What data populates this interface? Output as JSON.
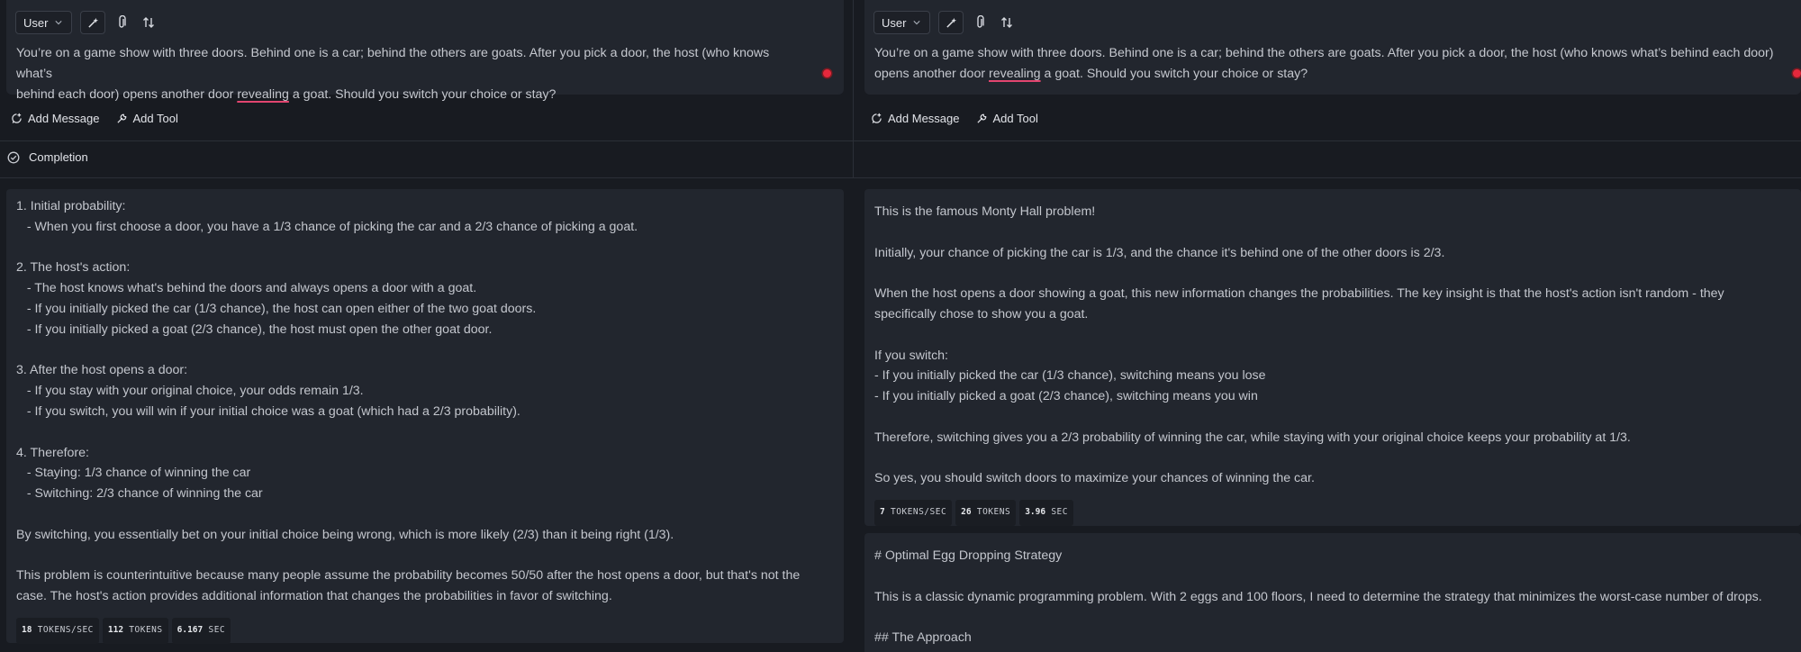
{
  "left": {
    "role": "User",
    "prompt_before": "You’re on a game show with three doors. Behind one is a car; behind the others are goats. After you pick a door, the host (who knows what’s",
    "prompt_line2_a": "behind each door) opens another door ",
    "prompt_misspelled": "revealing",
    "prompt_line2_b": " a goat. Should you switch your choice or stay?",
    "add_message": "Add Message",
    "add_tool": "Add Tool",
    "response_lines": [
      "1. Initial probability:",
      "   - When you first choose a door, you have a 1/3 chance of picking the car and a 2/3 chance of picking a goat.",
      "",
      "2. The host's action:",
      "   - The host knows what's behind the doors and always opens a door with a goat.",
      "   - If you initially picked the car (1/3 chance), the host can open either of the two goat doors.",
      "   - If you initially picked a goat (2/3 chance), the host must open the other goat door.",
      "",
      "3. After the host opens a door:",
      "   - If you stay with your original choice, your odds remain 1/3.",
      "   - If you switch, you will win if your initial choice was a goat (which had a 2/3 probability).",
      "",
      "4. Therefore:",
      "   - Staying: 1/3 chance of winning the car",
      "   - Switching: 2/3 chance of winning the car",
      "",
      "By switching, you essentially bet on your initial choice being wrong, which is more likely (2/3) than it being right (1/3).",
      "",
      "This problem is counterintuitive because many people assume the probability becomes 50/50 after the host opens a door, but that's not the",
      "case. The host's action provides additional information that changes the probabilities in favor of switching."
    ],
    "stats": {
      "tps": "18",
      "tps_label": "TOKENS/SEC",
      "tokens": "112",
      "tokens_label": "TOKENS",
      "sec": "6.167",
      "sec_label": "SEC"
    }
  },
  "right": {
    "role": "User",
    "prompt_before": "You’re on a game show with three doors. Behind one is a car; behind the others are goats. After you pick a door, the host (who knows what’s behind each door)",
    "prompt_line2_a": "opens another door ",
    "prompt_misspelled": "revealing",
    "prompt_line2_b": " a goat. Should you switch your choice or stay?",
    "add_message": "Add Message",
    "add_tool": "Add Tool",
    "response_lines": [
      "This is the famous Monty Hall problem!",
      "",
      "Initially, your chance of picking the car is 1/3, and the chance it's behind one of the other doors is 2/3.",
      "",
      "When the host opens a door showing a goat, this new information changes the probabilities. The key insight is that the host's action isn't random - they",
      "specifically chose to show you a goat.",
      "",
      "If you switch:",
      "- If you initially picked the car (1/3 chance), switching means you lose",
      "- If you initially picked a goat (2/3 chance), switching means you win",
      "",
      "Therefore, switching gives you a 2/3 probability of winning the car, while staying with your original choice keeps your probability at 1/3.",
      "",
      "So yes, you should switch doors to maximize your chances of winning the car."
    ],
    "stats": {
      "tps": "7",
      "tps_label": "TOKENS/SEC",
      "tokens": "26",
      "tokens_label": "TOKENS",
      "sec": "3.96",
      "sec_label": "SEC"
    },
    "response2_lines": [
      "# Optimal Egg Dropping Strategy",
      "",
      "This is a classic dynamic programming problem. With 2 eggs and 100 floors, I need to determine the strategy that minimizes the worst-case number of drops.",
      "",
      "## The Approach"
    ]
  },
  "completion_label": "Completion",
  "colors": {
    "accent_dot": "#e5283c",
    "misspell_underline": "#e2456f"
  }
}
